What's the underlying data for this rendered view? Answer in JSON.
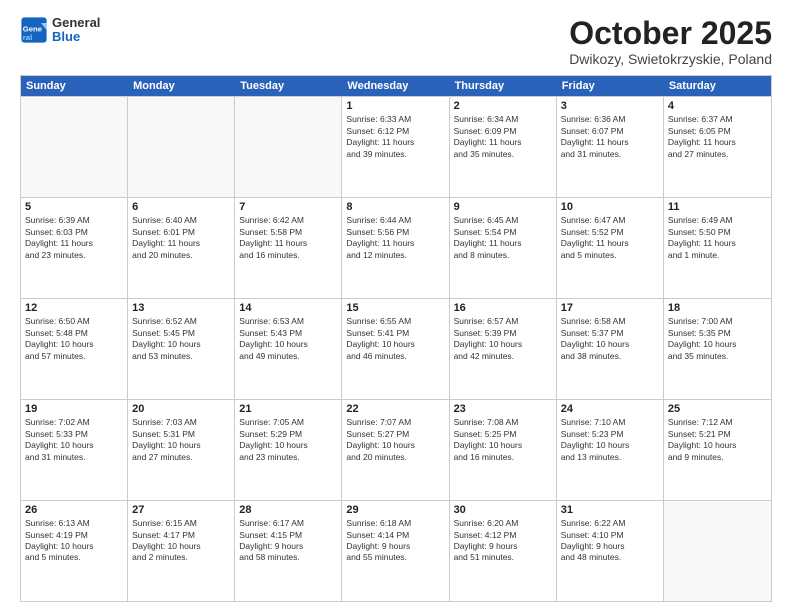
{
  "header": {
    "logo_general": "General",
    "logo_blue": "Blue",
    "month_title": "October 2025",
    "location": "Dwikozy, Swietokrzyskie, Poland"
  },
  "days_of_week": [
    "Sunday",
    "Monday",
    "Tuesday",
    "Wednesday",
    "Thursday",
    "Friday",
    "Saturday"
  ],
  "weeks": [
    [
      {
        "day": "",
        "empty": true,
        "lines": []
      },
      {
        "day": "",
        "empty": true,
        "lines": []
      },
      {
        "day": "",
        "empty": true,
        "lines": []
      },
      {
        "day": "1",
        "empty": false,
        "lines": [
          "Sunrise: 6:33 AM",
          "Sunset: 6:12 PM",
          "Daylight: 11 hours",
          "and 39 minutes."
        ]
      },
      {
        "day": "2",
        "empty": false,
        "lines": [
          "Sunrise: 6:34 AM",
          "Sunset: 6:09 PM",
          "Daylight: 11 hours",
          "and 35 minutes."
        ]
      },
      {
        "day": "3",
        "empty": false,
        "lines": [
          "Sunrise: 6:36 AM",
          "Sunset: 6:07 PM",
          "Daylight: 11 hours",
          "and 31 minutes."
        ]
      },
      {
        "day": "4",
        "empty": false,
        "lines": [
          "Sunrise: 6:37 AM",
          "Sunset: 6:05 PM",
          "Daylight: 11 hours",
          "and 27 minutes."
        ]
      }
    ],
    [
      {
        "day": "5",
        "empty": false,
        "lines": [
          "Sunrise: 6:39 AM",
          "Sunset: 6:03 PM",
          "Daylight: 11 hours",
          "and 23 minutes."
        ]
      },
      {
        "day": "6",
        "empty": false,
        "lines": [
          "Sunrise: 6:40 AM",
          "Sunset: 6:01 PM",
          "Daylight: 11 hours",
          "and 20 minutes."
        ]
      },
      {
        "day": "7",
        "empty": false,
        "lines": [
          "Sunrise: 6:42 AM",
          "Sunset: 5:58 PM",
          "Daylight: 11 hours",
          "and 16 minutes."
        ]
      },
      {
        "day": "8",
        "empty": false,
        "lines": [
          "Sunrise: 6:44 AM",
          "Sunset: 5:56 PM",
          "Daylight: 11 hours",
          "and 12 minutes."
        ]
      },
      {
        "day": "9",
        "empty": false,
        "lines": [
          "Sunrise: 6:45 AM",
          "Sunset: 5:54 PM",
          "Daylight: 11 hours",
          "and 8 minutes."
        ]
      },
      {
        "day": "10",
        "empty": false,
        "lines": [
          "Sunrise: 6:47 AM",
          "Sunset: 5:52 PM",
          "Daylight: 11 hours",
          "and 5 minutes."
        ]
      },
      {
        "day": "11",
        "empty": false,
        "lines": [
          "Sunrise: 6:49 AM",
          "Sunset: 5:50 PM",
          "Daylight: 11 hours",
          "and 1 minute."
        ]
      }
    ],
    [
      {
        "day": "12",
        "empty": false,
        "lines": [
          "Sunrise: 6:50 AM",
          "Sunset: 5:48 PM",
          "Daylight: 10 hours",
          "and 57 minutes."
        ]
      },
      {
        "day": "13",
        "empty": false,
        "lines": [
          "Sunrise: 6:52 AM",
          "Sunset: 5:45 PM",
          "Daylight: 10 hours",
          "and 53 minutes."
        ]
      },
      {
        "day": "14",
        "empty": false,
        "lines": [
          "Sunrise: 6:53 AM",
          "Sunset: 5:43 PM",
          "Daylight: 10 hours",
          "and 49 minutes."
        ]
      },
      {
        "day": "15",
        "empty": false,
        "lines": [
          "Sunrise: 6:55 AM",
          "Sunset: 5:41 PM",
          "Daylight: 10 hours",
          "and 46 minutes."
        ]
      },
      {
        "day": "16",
        "empty": false,
        "lines": [
          "Sunrise: 6:57 AM",
          "Sunset: 5:39 PM",
          "Daylight: 10 hours",
          "and 42 minutes."
        ]
      },
      {
        "day": "17",
        "empty": false,
        "lines": [
          "Sunrise: 6:58 AM",
          "Sunset: 5:37 PM",
          "Daylight: 10 hours",
          "and 38 minutes."
        ]
      },
      {
        "day": "18",
        "empty": false,
        "lines": [
          "Sunrise: 7:00 AM",
          "Sunset: 5:35 PM",
          "Daylight: 10 hours",
          "and 35 minutes."
        ]
      }
    ],
    [
      {
        "day": "19",
        "empty": false,
        "lines": [
          "Sunrise: 7:02 AM",
          "Sunset: 5:33 PM",
          "Daylight: 10 hours",
          "and 31 minutes."
        ]
      },
      {
        "day": "20",
        "empty": false,
        "lines": [
          "Sunrise: 7:03 AM",
          "Sunset: 5:31 PM",
          "Daylight: 10 hours",
          "and 27 minutes."
        ]
      },
      {
        "day": "21",
        "empty": false,
        "lines": [
          "Sunrise: 7:05 AM",
          "Sunset: 5:29 PM",
          "Daylight: 10 hours",
          "and 23 minutes."
        ]
      },
      {
        "day": "22",
        "empty": false,
        "lines": [
          "Sunrise: 7:07 AM",
          "Sunset: 5:27 PM",
          "Daylight: 10 hours",
          "and 20 minutes."
        ]
      },
      {
        "day": "23",
        "empty": false,
        "lines": [
          "Sunrise: 7:08 AM",
          "Sunset: 5:25 PM",
          "Daylight: 10 hours",
          "and 16 minutes."
        ]
      },
      {
        "day": "24",
        "empty": false,
        "lines": [
          "Sunrise: 7:10 AM",
          "Sunset: 5:23 PM",
          "Daylight: 10 hours",
          "and 13 minutes."
        ]
      },
      {
        "day": "25",
        "empty": false,
        "lines": [
          "Sunrise: 7:12 AM",
          "Sunset: 5:21 PM",
          "Daylight: 10 hours",
          "and 9 minutes."
        ]
      }
    ],
    [
      {
        "day": "26",
        "empty": false,
        "lines": [
          "Sunrise: 6:13 AM",
          "Sunset: 4:19 PM",
          "Daylight: 10 hours",
          "and 5 minutes."
        ]
      },
      {
        "day": "27",
        "empty": false,
        "lines": [
          "Sunrise: 6:15 AM",
          "Sunset: 4:17 PM",
          "Daylight: 10 hours",
          "and 2 minutes."
        ]
      },
      {
        "day": "28",
        "empty": false,
        "lines": [
          "Sunrise: 6:17 AM",
          "Sunset: 4:15 PM",
          "Daylight: 9 hours",
          "and 58 minutes."
        ]
      },
      {
        "day": "29",
        "empty": false,
        "lines": [
          "Sunrise: 6:18 AM",
          "Sunset: 4:14 PM",
          "Daylight: 9 hours",
          "and 55 minutes."
        ]
      },
      {
        "day": "30",
        "empty": false,
        "lines": [
          "Sunrise: 6:20 AM",
          "Sunset: 4:12 PM",
          "Daylight: 9 hours",
          "and 51 minutes."
        ]
      },
      {
        "day": "31",
        "empty": false,
        "lines": [
          "Sunrise: 6:22 AM",
          "Sunset: 4:10 PM",
          "Daylight: 9 hours",
          "and 48 minutes."
        ]
      },
      {
        "day": "",
        "empty": true,
        "lines": []
      }
    ]
  ]
}
